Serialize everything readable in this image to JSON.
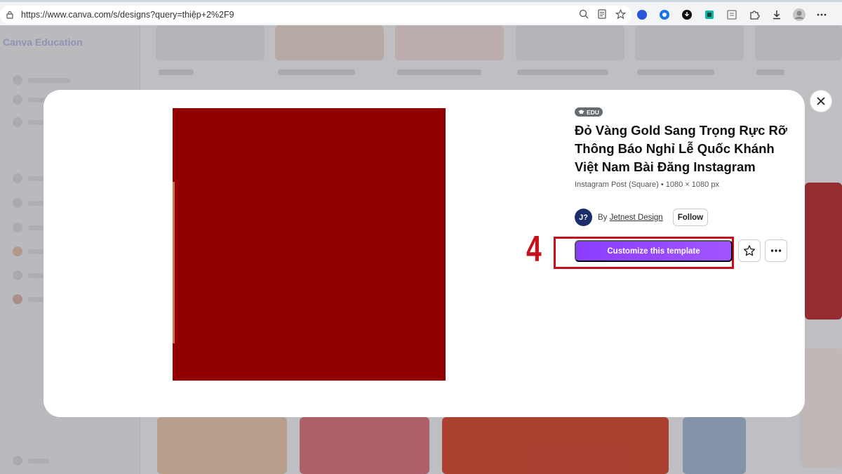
{
  "browser": {
    "url": "https://www.canva.com/s/designs?query=thiệp+2%2F9"
  },
  "background": {
    "logo": "Canva Education"
  },
  "modal": {
    "badge": "EDU",
    "title": "Đỏ Vàng Gold Sang Trọng Rực Rỡ Thông Báo Nghỉ Lễ Quốc Khánh Việt Nam Bài Đăng Instagram",
    "subtitle": "Instagram Post (Square) • 1080 × 1080 px",
    "author": {
      "avatar_initials": "J?",
      "by_label": "By",
      "name": "Jetnest Design",
      "follow_label": "Follow"
    },
    "cta_label": "Customize this template",
    "step_number": "4"
  },
  "colors": {
    "accent": "#8b3dff",
    "highlight": "#c8101a",
    "preview": "#900000"
  }
}
